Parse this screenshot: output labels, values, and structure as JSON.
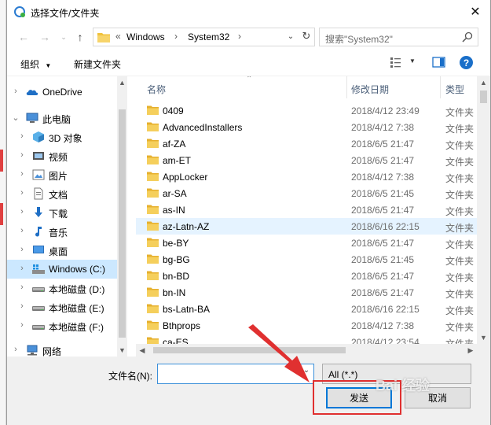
{
  "window": {
    "title": "选择文件/文件夹",
    "close": "✕"
  },
  "address": {
    "prefix": "«",
    "crumbs": [
      "Windows",
      "System32"
    ],
    "search_placeholder": "搜索\"System32\""
  },
  "toolbar": {
    "organize": "组织",
    "new_folder": "新建文件夹"
  },
  "nav": [
    {
      "label": "OneDrive",
      "icon": "onedrive-icon",
      "chev": "›"
    },
    {
      "label": "此电脑",
      "icon": "computer-icon",
      "chev": "⌄"
    },
    {
      "label": "3D 对象",
      "icon": "3d-objects-icon",
      "chev": "›"
    },
    {
      "label": "视频",
      "icon": "video-icon",
      "chev": "›"
    },
    {
      "label": "图片",
      "icon": "pictures-icon",
      "chev": "›"
    },
    {
      "label": "文档",
      "icon": "documents-icon",
      "chev": "›"
    },
    {
      "label": "下载",
      "icon": "downloads-icon",
      "chev": "›"
    },
    {
      "label": "音乐",
      "icon": "music-icon",
      "chev": "›"
    },
    {
      "label": "桌面",
      "icon": "desktop-icon",
      "chev": "›"
    },
    {
      "label": "Windows (C:)",
      "icon": "windows-drive-icon",
      "chev": "›",
      "selected": true
    },
    {
      "label": "本地磁盘 (D:)",
      "icon": "disk-icon",
      "chev": "›"
    },
    {
      "label": "本地磁盘 (E:)",
      "icon": "disk-icon",
      "chev": "›"
    },
    {
      "label": "本地磁盘 (F:)",
      "icon": "disk-icon",
      "chev": "›"
    },
    {
      "label": "网络",
      "icon": "network-icon",
      "chev": "›"
    }
  ],
  "columns": {
    "name": "名称",
    "date": "修改日期",
    "type": "类型"
  },
  "files": [
    {
      "name": "0409",
      "date": "2018/4/12 23:49",
      "type": "文件夹"
    },
    {
      "name": "AdvancedInstallers",
      "date": "2018/4/12 7:38",
      "type": "文件夹"
    },
    {
      "name": "af-ZA",
      "date": "2018/6/5 21:47",
      "type": "文件夹"
    },
    {
      "name": "am-ET",
      "date": "2018/6/5 21:47",
      "type": "文件夹"
    },
    {
      "name": "AppLocker",
      "date": "2018/4/12 7:38",
      "type": "文件夹"
    },
    {
      "name": "ar-SA",
      "date": "2018/6/5 21:45",
      "type": "文件夹"
    },
    {
      "name": "as-IN",
      "date": "2018/6/5 21:47",
      "type": "文件夹"
    },
    {
      "name": "az-Latn-AZ",
      "date": "2018/6/16 22:15",
      "type": "文件夹",
      "hover": true
    },
    {
      "name": "be-BY",
      "date": "2018/6/5 21:47",
      "type": "文件夹"
    },
    {
      "name": "bg-BG",
      "date": "2018/6/5 21:45",
      "type": "文件夹"
    },
    {
      "name": "bn-BD",
      "date": "2018/6/5 21:47",
      "type": "文件夹"
    },
    {
      "name": "bn-IN",
      "date": "2018/6/5 21:47",
      "type": "文件夹"
    },
    {
      "name": "bs-Latn-BA",
      "date": "2018/6/16 22:15",
      "type": "文件夹"
    },
    {
      "name": "Bthprops",
      "date": "2018/4/12 7:38",
      "type": "文件夹"
    },
    {
      "name": "ca-ES",
      "date": "2018/4/12 23:54",
      "type": "文件夹"
    }
  ],
  "bottom": {
    "filename_label": "文件名(N):",
    "filename_value": "",
    "filter": "All (*.*)",
    "send": "发送",
    "cancel": "取消"
  },
  "watermark": "Bai 经验",
  "colors": {
    "selection": "#cce8ff",
    "hover": "#e5f3ff",
    "folder": "#f0c23b",
    "annotation": "#e03030",
    "accent": "#0078d7"
  }
}
